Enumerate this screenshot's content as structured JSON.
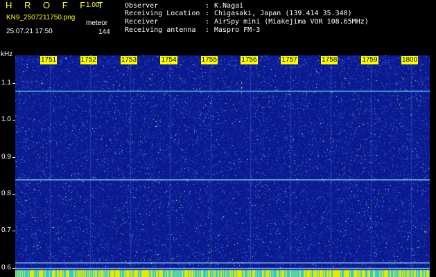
{
  "header": {
    "app_title": "H R O F F T",
    "version": "1.00f",
    "file_name": "KN9_2507211750.png",
    "timestamp": "25.07.21 17:50",
    "mode": "meteor",
    "count": "144"
  },
  "info": [
    {
      "label": "Observer",
      "value": "K.Nagai"
    },
    {
      "label": "Receiving Location",
      "value": "Chigasaki, Japan (139.414 35.340)"
    },
    {
      "label": "Receiver",
      "value": "AirSpy mini (Miakejima VOR 108.65MHz)"
    },
    {
      "label": "Receiving antenna",
      "value": "Maspro FM-3"
    }
  ],
  "spectrogram": {
    "y_unit": "kHz",
    "y_labels": [
      "1.1",
      "1.0",
      "0.9",
      "0.8",
      "0.7",
      "0.6"
    ],
    "y_range": [
      0.575,
      1.175
    ],
    "x_labels": [
      "1751",
      "1752",
      "1753",
      "1754",
      "1755",
      "1756",
      "1757",
      "1758",
      "1759",
      "1800"
    ],
    "x_label_minutes": [
      17.85,
      18.83,
      19.82,
      20.8,
      21.79,
      22.77,
      23.76,
      24.74,
      25.73,
      26.71
    ],
    "x_range_minutes": [
      17.0,
      27.17
    ],
    "carrier_freqs_khz": [
      1.08,
      0.84,
      0.615,
      0.6
    ],
    "colors": {
      "background": "#0c1a90",
      "noise": "#2c58d8",
      "bright": "#ffff55",
      "cyan": "#66ddff",
      "bottom_bar_yellow": "#e8e800",
      "bottom_bar_cyan": "#22c8f0"
    }
  }
}
